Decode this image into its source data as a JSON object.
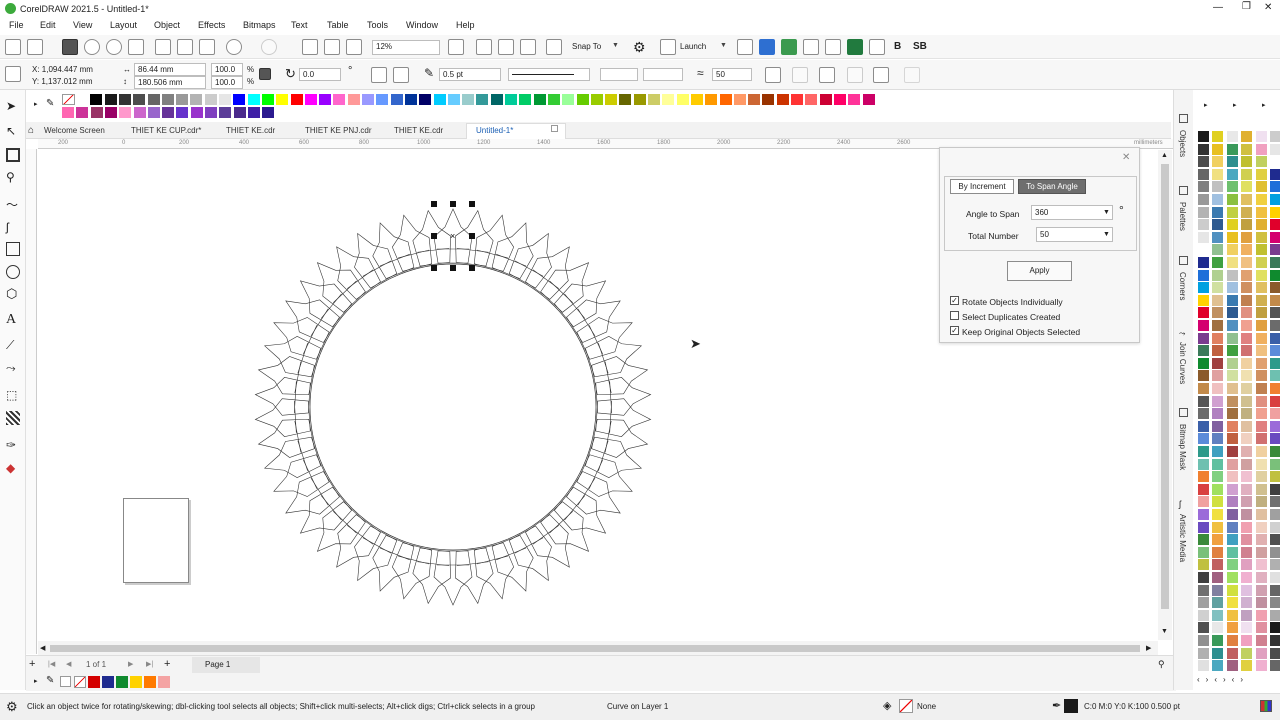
{
  "app": {
    "title": "CorelDRAW 2021.5 - Untitled-1*"
  },
  "window_controls": {
    "minimize": "—",
    "maximize": "❐",
    "close": "✕"
  },
  "menu": [
    "File",
    "Edit",
    "View",
    "Layout",
    "Object",
    "Effects",
    "Bitmaps",
    "Text",
    "Table",
    "Tools",
    "Window",
    "Help"
  ],
  "toolbar": {
    "zoom": "12%",
    "snap_to": "Snap To",
    "launch": "Launch",
    "cs_label": "SB",
    "b_label": "B"
  },
  "propbar": {
    "x": "X: 1,094.447 mm",
    "y": "Y: 1,137.012 mm",
    "w": "86.44 mm",
    "h": "180.506 mm",
    "scale_w": "100.0",
    "scale_h": "100.0",
    "pct": "%",
    "angle": "0.0",
    "deg": "°",
    "outline_width": "0.5 pt",
    "corner_val": "50"
  },
  "doc_tabs": [
    "Welcome Screen",
    "THIET KE CUP.cdr*",
    "THIET KE.cdr",
    "THIET KE PNJ.cdr",
    "THIET KE.cdr",
    "Untitled-1*"
  ],
  "ruler_h": [
    "200",
    "0",
    "200",
    "400",
    "600",
    "800",
    "1000",
    "1200",
    "1400",
    "1600",
    "1800",
    "2000",
    "2200",
    "2400",
    "2600"
  ],
  "ruler_unit": "millimeters",
  "dialog": {
    "tab_increment": "By Increment",
    "tab_span": "To Span Angle",
    "angle_label": "Angle to Span",
    "angle_value": "360",
    "deg": "°",
    "total_label": "Total Number",
    "total_value": "50",
    "apply": "Apply",
    "options": [
      {
        "label": "Rotate Objects Individually",
        "checked": true
      },
      {
        "label": "Select Duplicates Created",
        "checked": false
      },
      {
        "label": "Keep Original Objects Selected",
        "checked": true
      }
    ]
  },
  "dockers": [
    "Objects",
    "Palettes",
    "Corners",
    "Join Curves",
    "Bitmap Mask",
    "Artistic Media"
  ],
  "pagebar": {
    "count": "1 of 1",
    "page": "Page 1"
  },
  "status": {
    "hint": "Click an object twice for rotating/skewing; dbl-clicking tool selects all objects; Shift+click multi-selects; Alt+click digs; Ctrl+click selects in a group",
    "layer": "Curve on Layer 1",
    "fill": "None",
    "outline": "C:0 M:0 Y:0 K:100  0.500 pt"
  },
  "palette_colors": [
    "#ffffff",
    "#000000",
    "#1a1a1a",
    "#333333",
    "#4d4d4d",
    "#666666",
    "#808080",
    "#999999",
    "#b3b3b3",
    "#cccccc",
    "#e6e6e6",
    "#0000ff",
    "#00ffff",
    "#00ff00",
    "#ffff00",
    "#ff0000",
    "#ff00ff",
    "#9900ff",
    "#ff66cc",
    "#ff9999",
    "#9999ff",
    "#6699ff",
    "#3366cc",
    "#003399",
    "#000066",
    "#00ccff",
    "#66ccff",
    "#99cccc",
    "#339999",
    "#006666",
    "#00cc99",
    "#00cc66",
    "#009933",
    "#33cc33",
    "#99ff99",
    "#66cc00",
    "#99cc00",
    "#cccc00",
    "#666600",
    "#999900",
    "#cccc66",
    "#ffff99",
    "#ffff66",
    "#ffcc00",
    "#ff9900",
    "#ff6600",
    "#ff9966",
    "#cc6633",
    "#993300",
    "#cc3300",
    "#ff3333",
    "#ff6666",
    "#cc0033",
    "#ff0066",
    "#ff3399",
    "#cc0066"
  ],
  "palette_colors_row2": [
    "#ff66b2",
    "#cc3399",
    "#993366",
    "#990066",
    "#ff99cc",
    "#cc66cc",
    "#9966cc",
    "#663399",
    "#6633cc",
    "#9933cc",
    "#7f3fbf",
    "#5c3d99",
    "#4b2a8c",
    "#3f1fa6",
    "#2b1a8f"
  ],
  "doc_palette": [
    "#d40000",
    "#1f2b8f",
    "#0f8a2e",
    "#ffd200",
    "#ff7a00",
    "#f4a3a3"
  ]
}
